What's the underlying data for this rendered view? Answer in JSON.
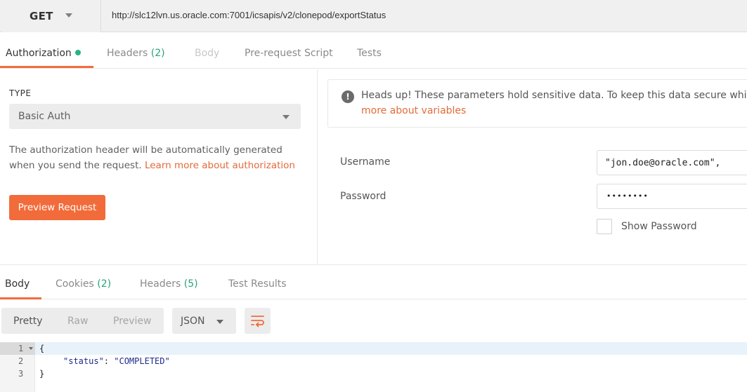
{
  "request": {
    "method": "GET",
    "url": "http://slc12lvn.us.oracle.com:7001/icsapis/v2/clonepod/exportStatus"
  },
  "request_tabs": [
    {
      "label": "Authorization",
      "count": ""
    },
    {
      "label": "Headers",
      "count": "(2)"
    },
    {
      "label": "Body",
      "count": ""
    },
    {
      "label": "Pre-request Script",
      "count": ""
    },
    {
      "label": "Tests",
      "count": ""
    }
  ],
  "auth": {
    "type_label": "TYPE",
    "type_value": "Basic Auth",
    "description": "The authorization header will be automatically generated when you send the request.",
    "learn_more": "Learn more about authorization",
    "preview_button": "Preview Request"
  },
  "notice": {
    "line1": "Heads up! These parameters hold sensitive data. To keep this data secure while w",
    "line2": "more about variables"
  },
  "fields": {
    "username_label": "Username",
    "username_value": "\"jon.doe@oracle.com\",",
    "password_label": "Password",
    "password_value": "••••••••",
    "show_password_label": "Show Password"
  },
  "response_tabs": [
    {
      "label": "Body",
      "count": ""
    },
    {
      "label": "Cookies",
      "count": "(2)"
    },
    {
      "label": "Headers",
      "count": "(5)"
    },
    {
      "label": "Test Results",
      "count": ""
    }
  ],
  "response_format": {
    "modes": [
      "Pretty",
      "Raw",
      "Preview"
    ],
    "language": "JSON"
  },
  "code": {
    "line_numbers": [
      "1",
      "2",
      "3"
    ],
    "open_brace": "{",
    "key": "\"status\"",
    "colon": ": ",
    "value": "\"COMPLETED\"",
    "close_brace": "}"
  },
  "colors": {
    "accent": "#f26b3a",
    "count_green": "#27a37a",
    "status_dot": "#26b47f",
    "link": "#e26b39"
  },
  "icons": {
    "method_caret": "chevron-down-icon",
    "status_dot": "status-dot-icon",
    "select_caret": "chevron-down-icon",
    "notice": "exclamation-icon",
    "wrap": "wrap-lines-icon",
    "fold": "fold-arrow-icon"
  }
}
